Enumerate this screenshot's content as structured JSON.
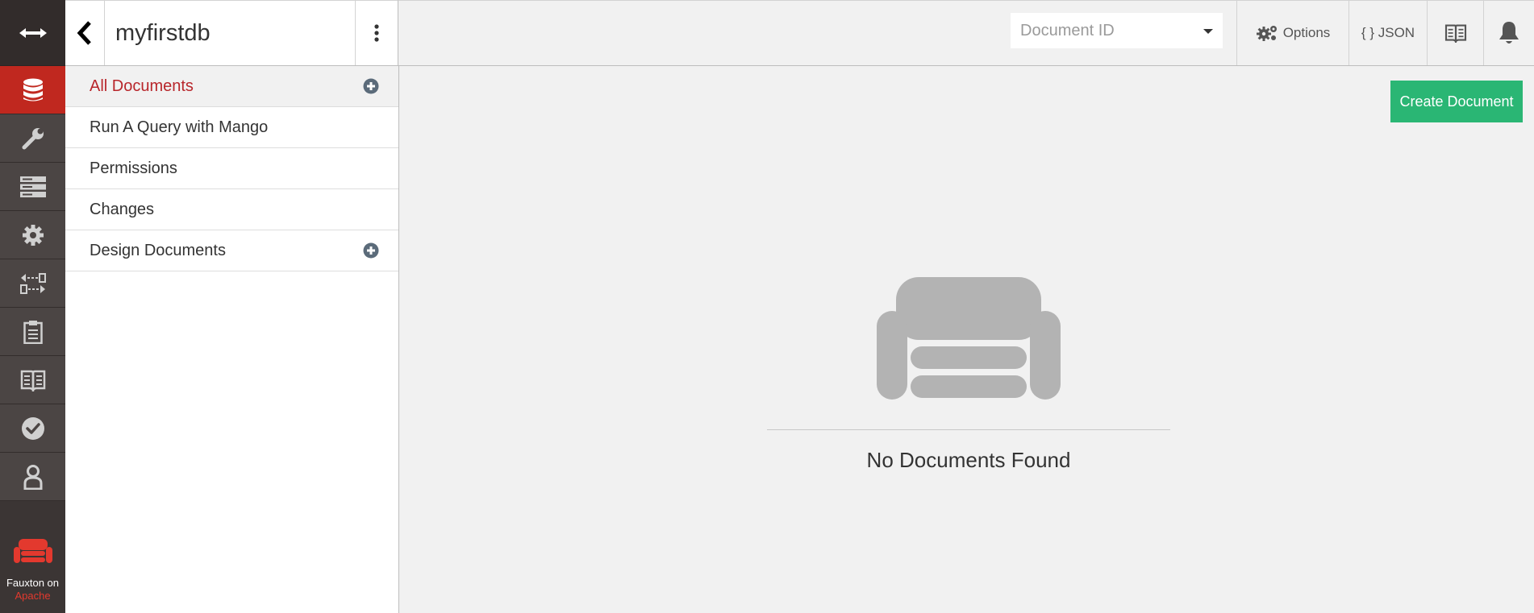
{
  "brand": {
    "line1": "Fauxton on",
    "line2": "Apache"
  },
  "header": {
    "db_name": "myfirstdb",
    "doc_id_placeholder": "Document ID",
    "options_label": "Options",
    "json_label": "{ } JSON"
  },
  "sidebar": {
    "items": [
      {
        "label": "All Documents"
      },
      {
        "label": "Run A Query with Mango"
      },
      {
        "label": "Permissions"
      },
      {
        "label": "Changes"
      },
      {
        "label": "Design Documents"
      }
    ]
  },
  "main": {
    "create_label": "Create Document",
    "empty_text": "No Documents Found"
  },
  "colors": {
    "accent": "#c0281f",
    "create": "#2ab674",
    "active_link": "#b8262b"
  }
}
